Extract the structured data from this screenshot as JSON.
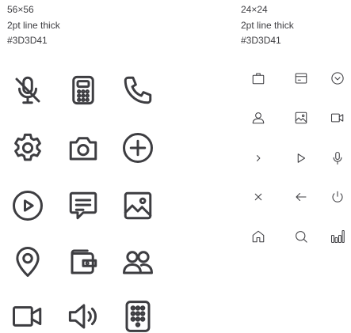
{
  "spec_large": {
    "size": "56×56",
    "stroke": "2pt line thick",
    "color": "#3D3D41"
  },
  "spec_small": {
    "size": "24×24",
    "stroke": "2pt line thick",
    "color": "#3D3D41"
  },
  "icon_color": "#3D3D41",
  "icons_large": [
    "mic-off-icon",
    "calculator-icon",
    "phone-icon",
    "gear-icon",
    "camera-icon",
    "plus-circle-icon",
    "play-circle-icon",
    "message-icon",
    "image-icon",
    "location-pin-icon",
    "wallet-icon",
    "users-icon",
    "video-camera-icon",
    "speaker-icon",
    "keypad-icon"
  ],
  "icons_small": [
    "briefcase-icon",
    "credit-card-icon",
    "chevron-down-circle-icon",
    "user-icon",
    "image-icon",
    "video-camera-icon",
    "chevron-right-icon",
    "play-icon",
    "microphone-icon",
    "close-icon",
    "arrow-left-icon",
    "power-icon",
    "home-icon",
    "search-icon",
    "bar-chart-icon"
  ]
}
